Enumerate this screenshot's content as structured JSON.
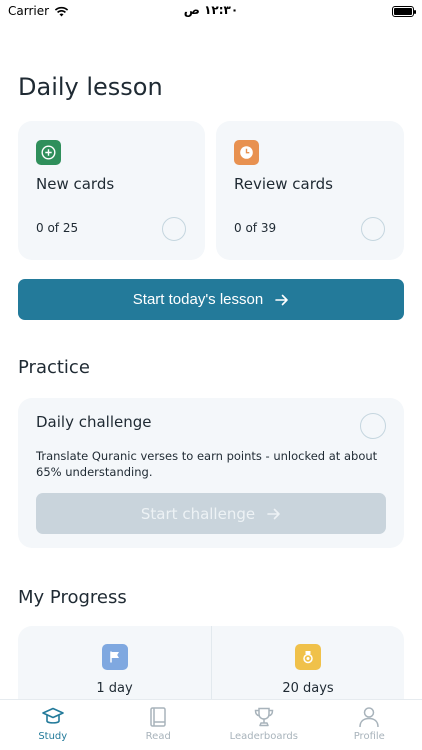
{
  "status_bar": {
    "carrier": "Carrier",
    "time": "١٢:٣٠ ص"
  },
  "daily": {
    "title": "Daily lesson",
    "new_cards": {
      "title": "New cards",
      "count": "0 of 25",
      "icon": "plus-icon",
      "color": "#2f8f5b"
    },
    "review_cards": {
      "title": "Review cards",
      "count": "0 of 39",
      "icon": "clock-icon",
      "color": "#e89150"
    },
    "start_button": "Start today's lesson"
  },
  "practice": {
    "title": "Practice",
    "challenge": {
      "title": "Daily challenge",
      "description": "Translate Quranic verses to earn points - unlocked at about 65% understanding.",
      "button": "Start challenge"
    }
  },
  "progress": {
    "title": "My Progress",
    "stats": [
      {
        "value": "1 day",
        "icon": "flag-icon",
        "color": "#7fa8e0"
      },
      {
        "value": "20 days",
        "icon": "medal-icon",
        "color": "#f0c14a"
      }
    ]
  },
  "tabs": [
    {
      "label": "Study",
      "icon": "study-cap-icon",
      "active": true
    },
    {
      "label": "Read",
      "icon": "book-icon",
      "active": false
    },
    {
      "label": "Leaderboards",
      "icon": "trophy-icon",
      "active": false
    },
    {
      "label": "Profile",
      "icon": "person-icon",
      "active": false
    }
  ],
  "colors": {
    "accent": "#237a9a",
    "card_bg": "#f4f7fa",
    "disabled": "#c9d4dc"
  }
}
